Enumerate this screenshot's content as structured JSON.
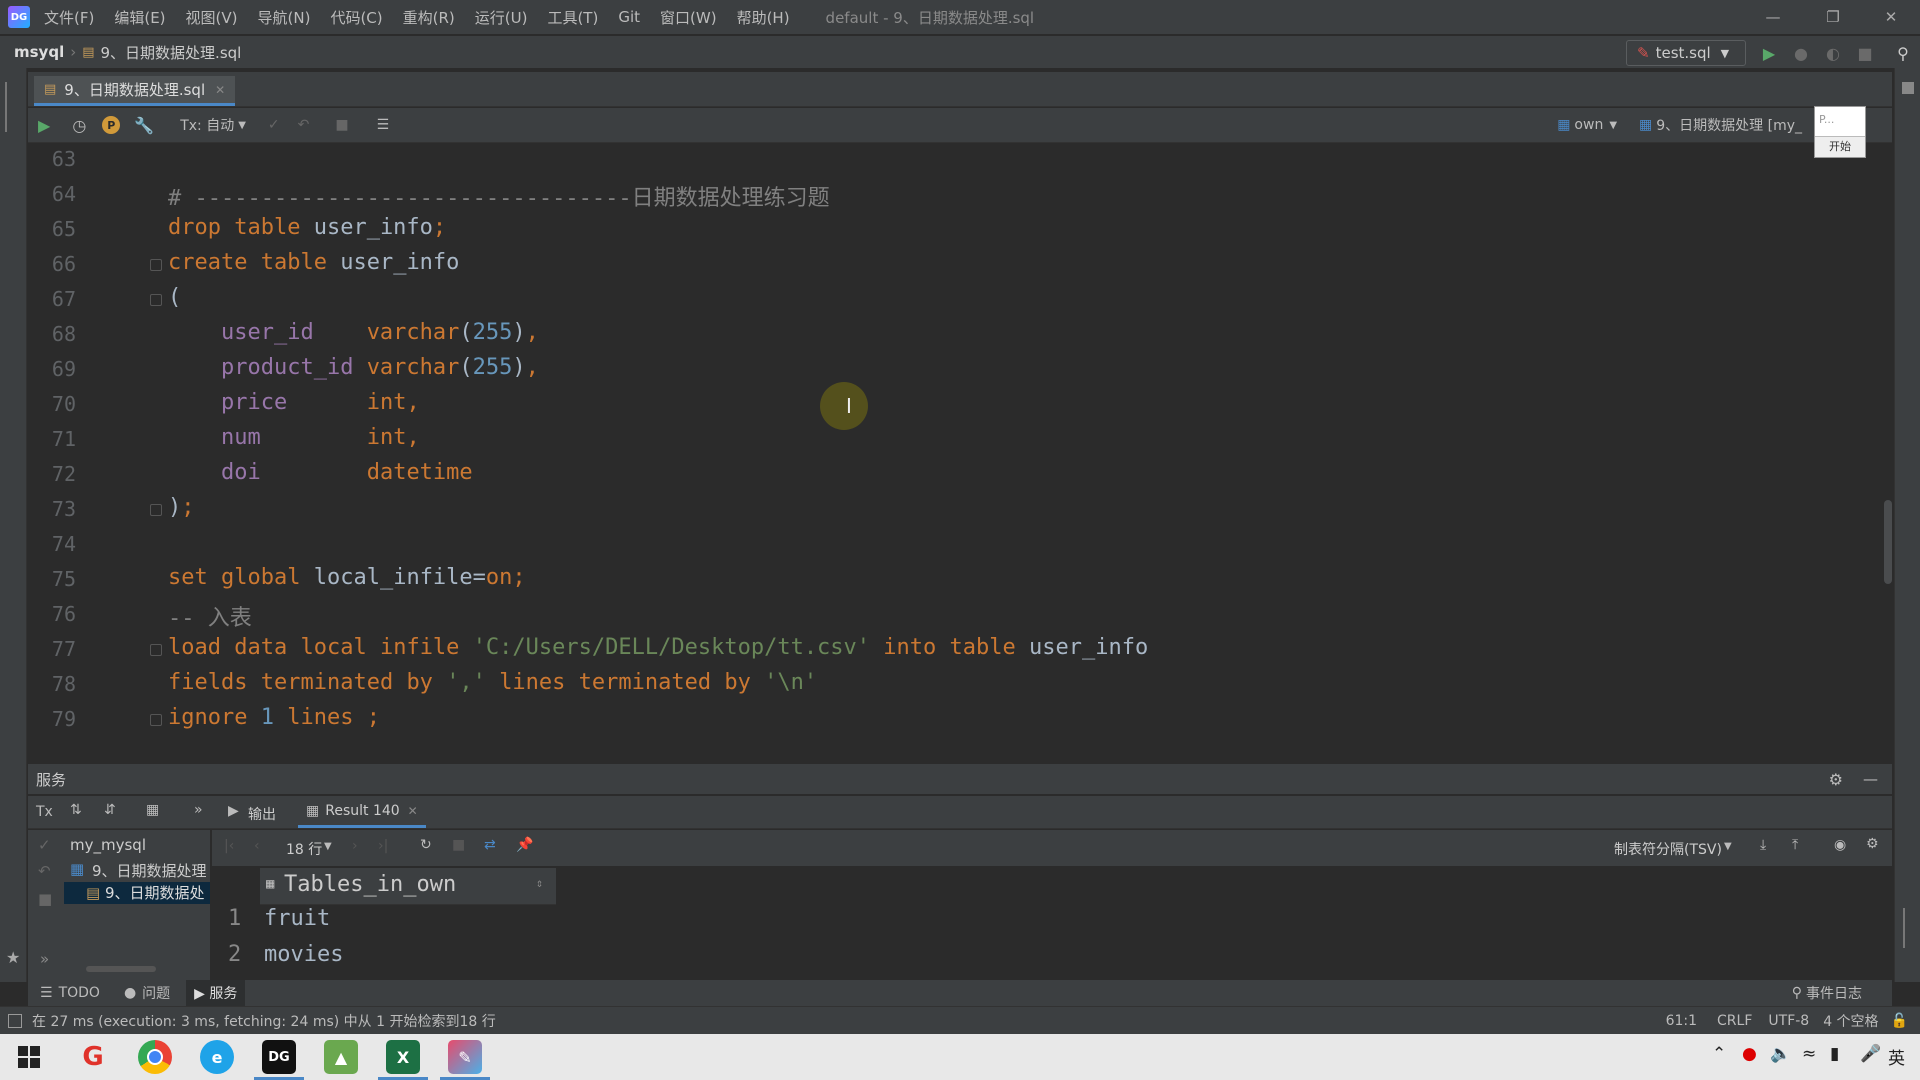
{
  "menu": {
    "items": [
      "文件(F)",
      "编辑(E)",
      "视图(V)",
      "导航(N)",
      "代码(C)",
      "重构(R)",
      "运行(U)",
      "工具(T)",
      "Git",
      "窗口(W)",
      "帮助(H)"
    ],
    "window_title": "default - 9、日期数据处理.sql"
  },
  "nav": {
    "project": "msyql",
    "file": "9、日期数据处理.sql",
    "run_config": "test.sql"
  },
  "editor_tab": {
    "label": "9、日期数据处理.sql"
  },
  "editor_toolbar": {
    "tx_label": "Tx: 自动",
    "schema": "own",
    "session": "9、日期数据处理 [my_"
  },
  "tooltip": {
    "text": "P...",
    "button": "开始"
  },
  "editor": {
    "lines": [
      {
        "n": "63",
        "text": ""
      },
      {
        "n": "64",
        "text": "# ---------------------------------日期数据处理练习题"
      },
      {
        "n": "65",
        "text": "drop table user_info;"
      },
      {
        "n": "66",
        "text": "create table user_info"
      },
      {
        "n": "67",
        "text": "("
      },
      {
        "n": "68",
        "text": "    user_id    varchar(255),"
      },
      {
        "n": "69",
        "text": "    product_id varchar(255),"
      },
      {
        "n": "70",
        "text": "    price      int,"
      },
      {
        "n": "71",
        "text": "    num        int,"
      },
      {
        "n": "72",
        "text": "    doi        datetime"
      },
      {
        "n": "73",
        "text": ");"
      },
      {
        "n": "74",
        "text": ""
      },
      {
        "n": "75",
        "text": "set global local_infile=on;"
      },
      {
        "n": "76",
        "text": "-- 入表"
      },
      {
        "n": "77",
        "text": "load data local infile 'C:/Users/DELL/Desktop/tt.csv' into table user_info"
      },
      {
        "n": "78",
        "text": "fields terminated by ',' lines terminated by '\\n'"
      },
      {
        "n": "79",
        "text": "ignore 1 lines ;"
      }
    ]
  },
  "services": {
    "header": "服务",
    "tab_output": "输出",
    "tab_result": "Result 140",
    "tree": [
      "my_mysql",
      "9、日期数据处理",
      "9、日期数据处"
    ],
    "rows_label": "18 行",
    "export_format": "制表符分隔(TSV)",
    "grid": {
      "column": "Tables_in_own",
      "rows": [
        {
          "n": "1",
          "v": "fruit"
        },
        {
          "n": "2",
          "v": "movies"
        }
      ]
    }
  },
  "tooltabs": {
    "todo": "TODO",
    "problems": "问题",
    "services": "服务",
    "event_log": "事件日志"
  },
  "status": {
    "message": "在 27 ms (execution: 3 ms, fetching: 24 ms) 中从 1 开始检索到18 行",
    "position": "61:1",
    "line_sep": "CRLF",
    "encoding": "UTF-8",
    "indent": "4 个空格"
  },
  "taskbar": {
    "ime": "英"
  }
}
